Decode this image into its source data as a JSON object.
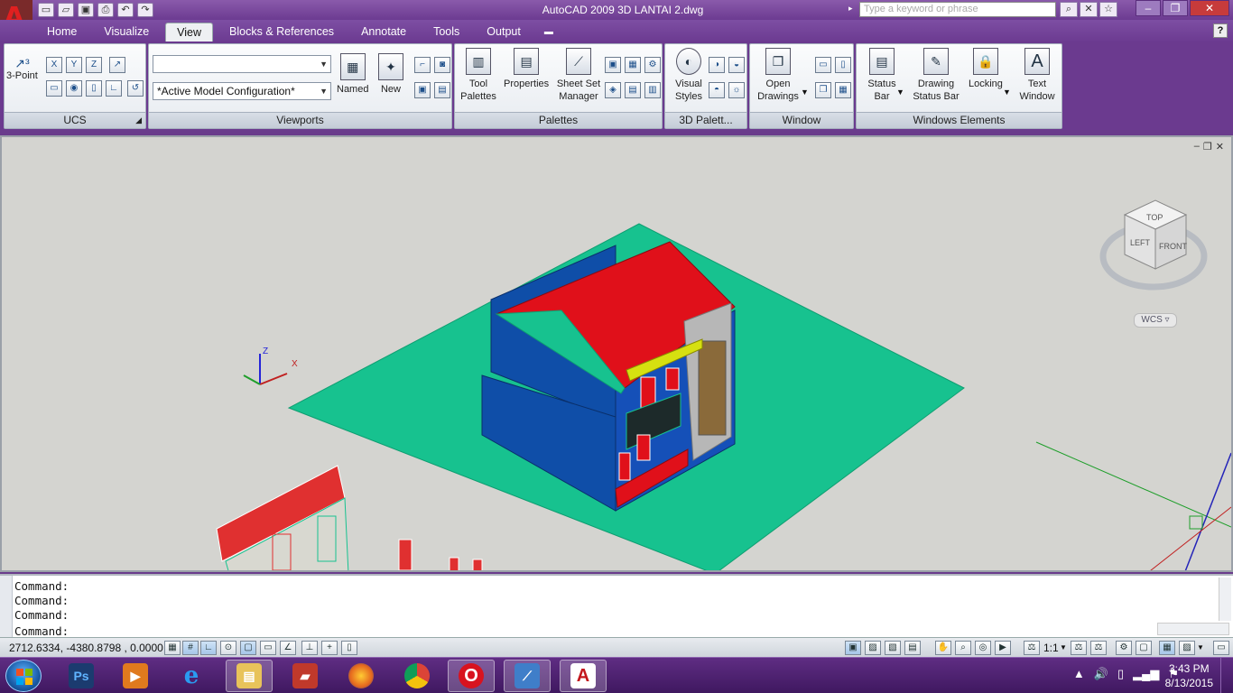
{
  "window": {
    "title": "AutoCAD 2009 3D LANTAI 2.dwg",
    "search_placeholder": "Type a keyword or phrase"
  },
  "tabs": [
    {
      "label": "Home"
    },
    {
      "label": "Visualize"
    },
    {
      "label": "View",
      "active": true
    },
    {
      "label": "Blocks & References"
    },
    {
      "label": "Annotate"
    },
    {
      "label": "Tools"
    },
    {
      "label": "Output"
    }
  ],
  "ribbon": {
    "ucs": {
      "title": "UCS",
      "btn_3point": "3-Point"
    },
    "viewports": {
      "title": "Viewports",
      "combo_top_value": "",
      "combo_config_value": "*Active Model Configuration*",
      "named_label": "Named",
      "new_label": "New"
    },
    "palettes": {
      "title": "Palettes",
      "tool_palettes": "Tool Palettes",
      "properties": "Properties",
      "sheet_set_manager": "Sheet Set Manager"
    },
    "palettes3d": {
      "title": "3D Palett...",
      "visual_styles": "Visual Styles"
    },
    "window": {
      "title": "Window",
      "open_drawings": "Open Drawings"
    },
    "windows_elements": {
      "title": "Windows Elements",
      "status_bar": "Status Bar",
      "drawing_status_bar": "Drawing Status Bar",
      "locking": "Locking",
      "text_window": "Text Window"
    }
  },
  "viewport": {
    "wcs_label": "WCS",
    "viewcube": {
      "top": "TOP",
      "left": "LEFT",
      "front": "FRONT"
    },
    "axes": {
      "z": "Z",
      "x": "X"
    }
  },
  "command": {
    "history": [
      "Command:",
      "Command:",
      "Command:"
    ],
    "prompt": "Command:"
  },
  "status": {
    "coordinates": "2712.6334, -4380.8798 , 0.0000",
    "scale": "1:1"
  },
  "taskbar": {
    "apps": [
      {
        "name": "Photoshop",
        "label": "Ps",
        "color": "#1b3b6f"
      },
      {
        "name": "Media Player",
        "label": "",
        "color": "#e07a1e"
      },
      {
        "name": "Internet Explorer",
        "label": "e",
        "color": "#1c7fd6"
      },
      {
        "name": "File Explorer",
        "label": "",
        "color": "#e8c35a"
      },
      {
        "name": "Books",
        "label": "",
        "color": "#c0392b"
      },
      {
        "name": "Firefox",
        "label": "",
        "color": "#e5681e"
      },
      {
        "name": "Chrome",
        "label": "",
        "color": "#2fa84f"
      },
      {
        "name": "Opera",
        "label": "O",
        "color": "#d8131f"
      },
      {
        "name": "Sketch",
        "label": "",
        "color": "#3f7ec9"
      },
      {
        "name": "AutoCAD",
        "label": "A",
        "color": "#c3161c"
      }
    ],
    "time": "3:43 PM",
    "date": "8/13/2015"
  }
}
